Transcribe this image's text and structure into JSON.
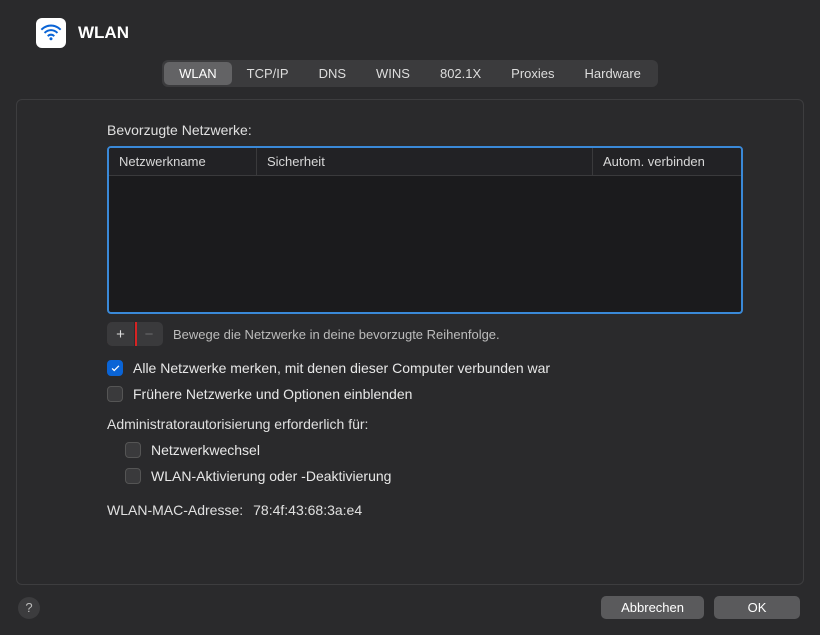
{
  "title": "WLAN",
  "tabs": [
    {
      "label": "WLAN",
      "active": true
    },
    {
      "label": "TCP/IP",
      "active": false
    },
    {
      "label": "DNS",
      "active": false
    },
    {
      "label": "WINS",
      "active": false
    },
    {
      "label": "802.1X",
      "active": false
    },
    {
      "label": "Proxies",
      "active": false
    },
    {
      "label": "Hardware",
      "active": false
    }
  ],
  "preferred_networks_label": "Bevorzugte Netzwerke:",
  "table": {
    "columns": {
      "name": "Netzwerkname",
      "security": "Sicherheit",
      "auto": "Autom. verbinden"
    },
    "rows": []
  },
  "reorder_hint": "Bewege die Netzwerke in deine bevorzugte Reihenfolge.",
  "remember_all": {
    "checked": true,
    "label": "Alle Netzwerke merken, mit denen dieser Computer verbunden war"
  },
  "show_previous": {
    "checked": false,
    "label": "Frühere Netzwerke und Optionen einblenden"
  },
  "admin_required_label": "Administratorautorisierung erforderlich für:",
  "admin_options": {
    "change_networks": {
      "checked": false,
      "label": "Netzwerkwechsel"
    },
    "wlan_toggle": {
      "checked": false,
      "label": "WLAN-Aktivierung oder -Deaktivierung"
    }
  },
  "mac_address_label": "WLAN-MAC-Adresse:",
  "mac_address_value": "78:4f:43:68:3a:e4",
  "buttons": {
    "cancel": "Abbrechen",
    "ok": "OK"
  },
  "icons": {
    "plus": "+",
    "minus": "−",
    "help": "?"
  }
}
